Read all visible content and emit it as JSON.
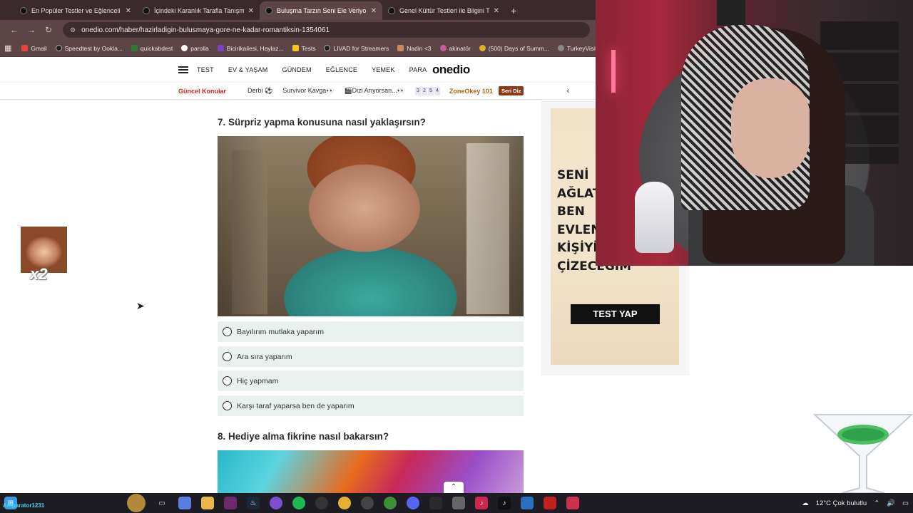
{
  "browser": {
    "tabs": [
      {
        "title": "En Popüler Testler ve Eğlenceli",
        "active": false
      },
      {
        "title": "İçindeki Karanlık Tarafla Tanışm",
        "active": false
      },
      {
        "title": "Buluşma Tarzın Seni Ele Veriyor",
        "active": true
      },
      {
        "title": "Genel Kültür Testleri ile Bilgini T",
        "active": false
      }
    ],
    "url": "onedio.com/haber/hazirladigin-bulusmaya-gore-ne-kadar-romantiksin-1354061",
    "bookmarks": [
      {
        "label": "Gmail",
        "color": "#ea4335"
      },
      {
        "label": "Speedtest by Ookla...",
        "color": "#222222"
      },
      {
        "label": "quickabdest",
        "color": "#2e7d32"
      },
      {
        "label": "parolla",
        "color": "#ffffff"
      },
      {
        "label": "Bicirikailesi, Haylaz...",
        "color": "#7b3fc4"
      },
      {
        "label": "Tests",
        "color": "#f5c518"
      },
      {
        "label": "LIVAD for Streamers",
        "color": "#222222"
      },
      {
        "label": "Nadin <3",
        "color": "#c98a5a"
      },
      {
        "label": "akinatör",
        "color": "#d05aa0"
      },
      {
        "label": "(500) Days of Summ...",
        "color": "#e0b020"
      },
      {
        "label": "TurkeyVisited",
        "color": "#888888"
      }
    ]
  },
  "site": {
    "nav": [
      "TEST",
      "EV & YAŞAM",
      "GÜNDEM",
      "EĞLENCE",
      "YEMEK",
      "PARA"
    ],
    "logo": "onedio",
    "subnav": {
      "hot_label": "Güncel Konular",
      "items": [
        "Derbi ⚽",
        "Survivor Kavga👀",
        "🎬Dizi Arıyorsan...👀"
      ],
      "nums": [
        "3",
        "2",
        "5",
        "4"
      ],
      "zone": "ZoneOkey 101",
      "badge": "Seri Diz"
    }
  },
  "quiz": {
    "q7": "7. Sürpriz yapma konusuna nasıl yaklaşırsın?",
    "options": [
      "Bayılırım mutlaka yaparım",
      "Ara sıra yaparım",
      "Hiç yapmam",
      "Karşı taraf yaparsa ben de yaparım"
    ],
    "q8": "8. Hediye alma fikrine nasıl bakarsın?"
  },
  "ad": {
    "lines": [
      "SENİ",
      "AĞLATAN",
      "BEN",
      "EVLENECEĞİM",
      "KİŞİYİ",
      "ÇİZECEĞİM"
    ],
    "button": "TEST YAP"
  },
  "overlay": {
    "emote_count": "x2",
    "username": "Amparator1231"
  },
  "taskbar": {
    "weather": "12°C  Çok bulutlu"
  }
}
